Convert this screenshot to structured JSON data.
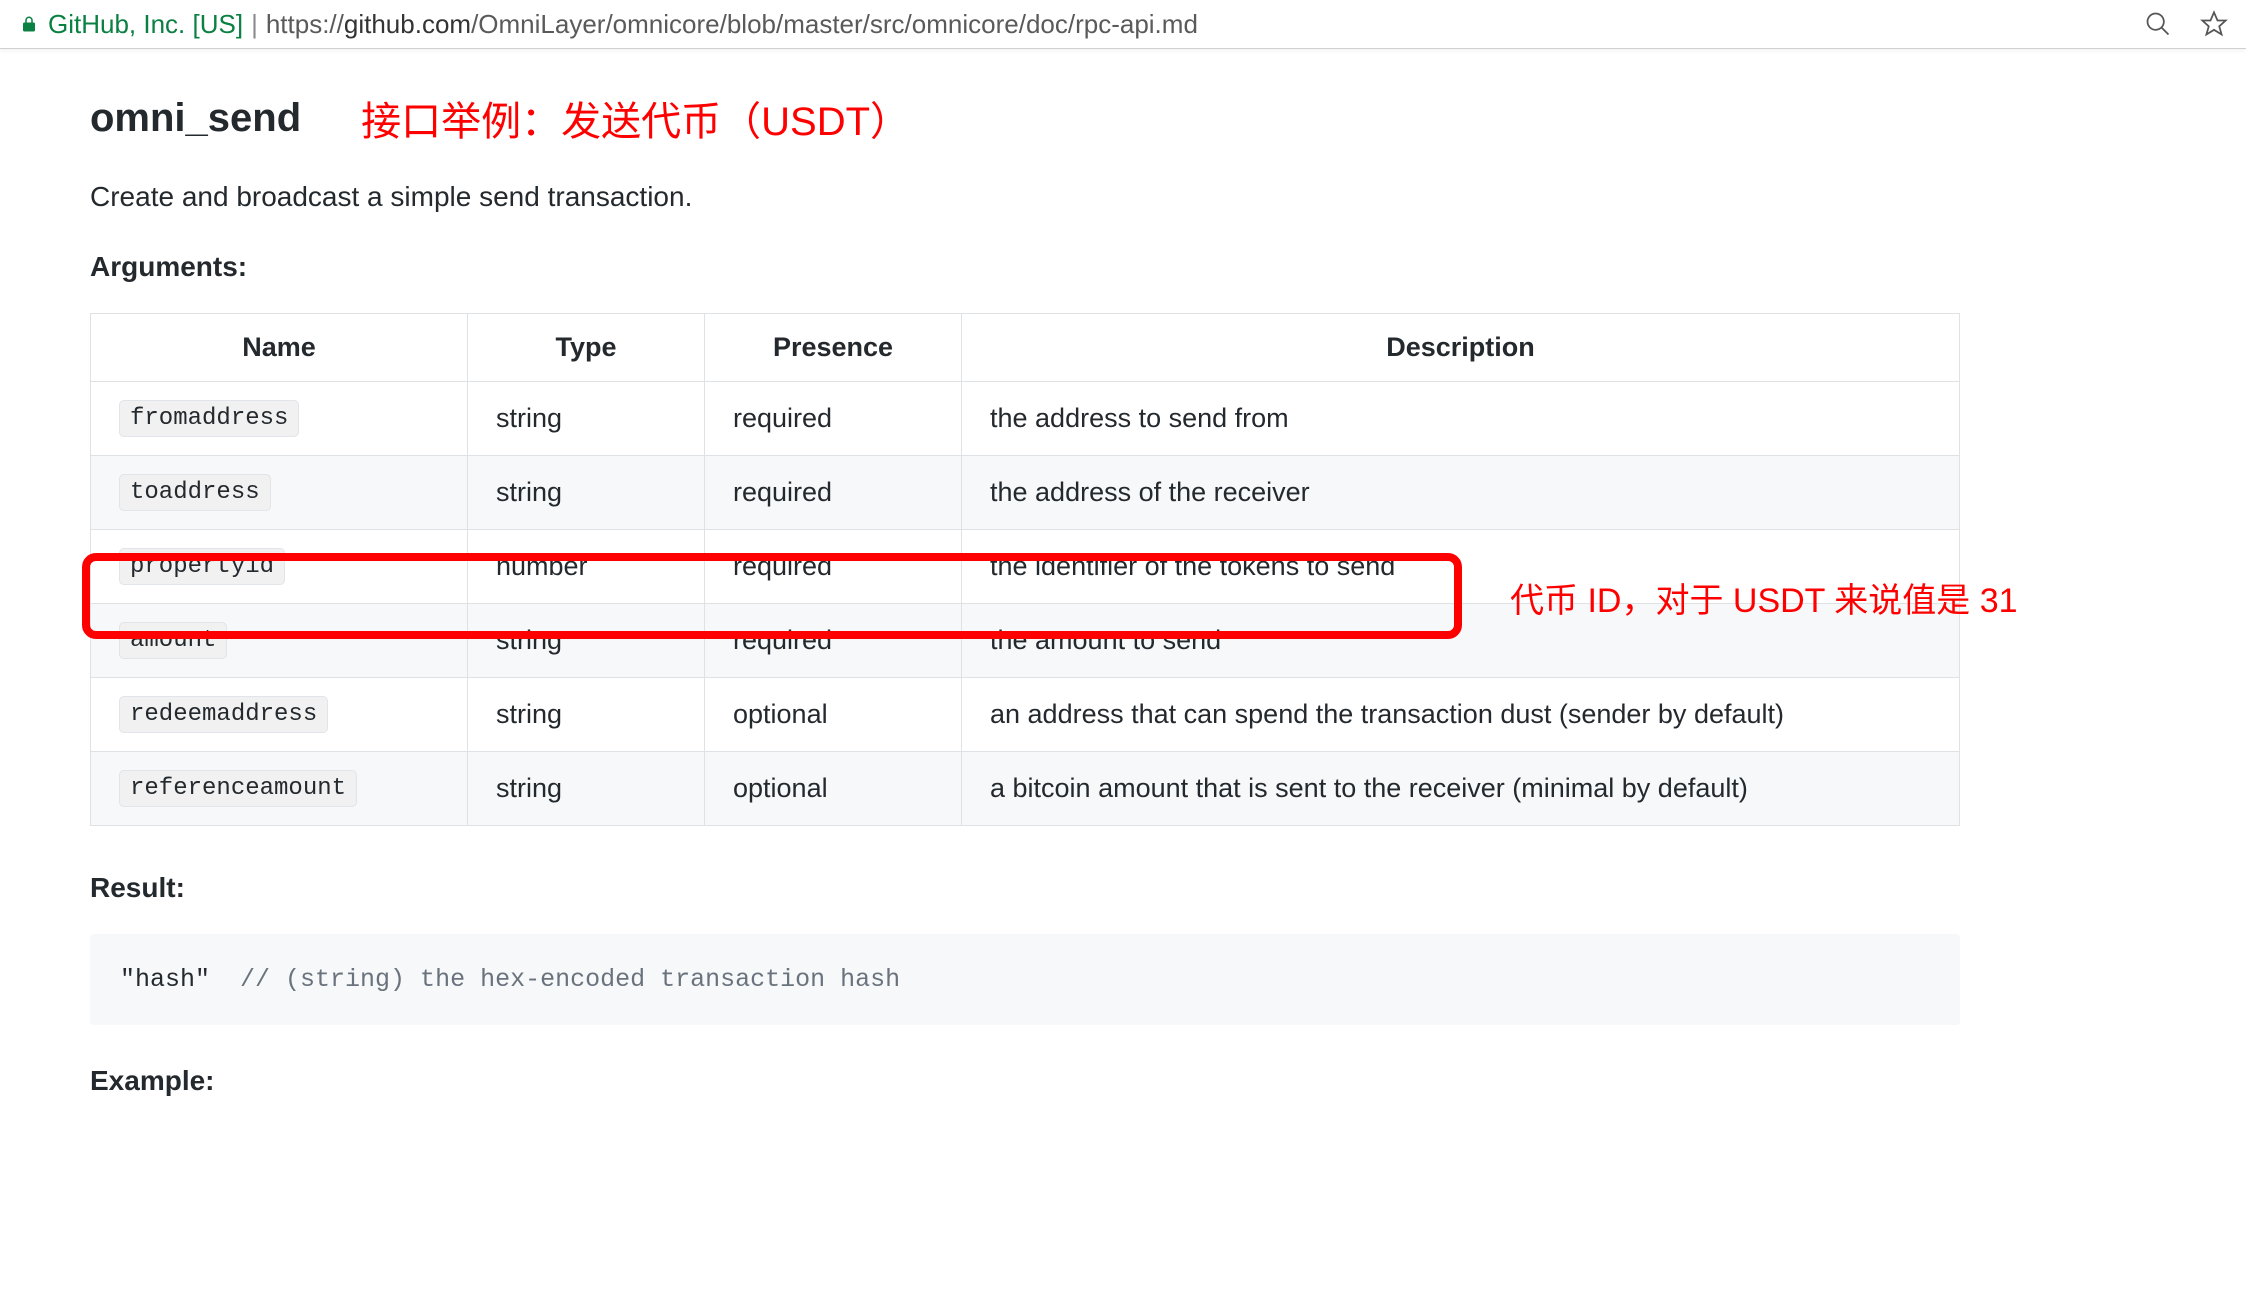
{
  "browser": {
    "site_name": "GitHub, Inc. [US]",
    "url_proto": "https://",
    "url_host": "github.com",
    "url_path": "/OmniLayer/omnicore/blob/master/src/omnicore/doc/rpc-api.md"
  },
  "headings": {
    "section_title": "omni_send",
    "annotation_title": "接口举例：发送代币（USDT）",
    "description": "Create and broadcast a simple send transaction.",
    "arguments_label": "Arguments:",
    "result_label": "Result:",
    "example_label": "Example:"
  },
  "table": {
    "head": {
      "name": "Name",
      "type": "Type",
      "presence": "Presence",
      "description": "Description"
    },
    "rows": [
      {
        "name": "fromaddress",
        "type": "string",
        "presence": "required",
        "description": "the address to send from"
      },
      {
        "name": "toaddress",
        "type": "string",
        "presence": "required",
        "description": "the address of the receiver"
      },
      {
        "name": "propertyid",
        "type": "number",
        "presence": "required",
        "description": "the identifier of the tokens to send"
      },
      {
        "name": "amount",
        "type": "string",
        "presence": "required",
        "description": "the amount to send"
      },
      {
        "name": "redeemaddress",
        "type": "string",
        "presence": "optional",
        "description": "an address that can spend the transaction dust (sender by default)"
      },
      {
        "name": "referenceamount",
        "type": "string",
        "presence": "optional",
        "description": "a bitcoin amount that is sent to the receiver (minimal by default)"
      }
    ],
    "highlight_row_annotation": "代币 ID，对于 USDT 来说值是 31"
  },
  "result": {
    "hash_literal": "\"hash\"",
    "comment": "// (string) the hex-encoded transaction hash"
  }
}
